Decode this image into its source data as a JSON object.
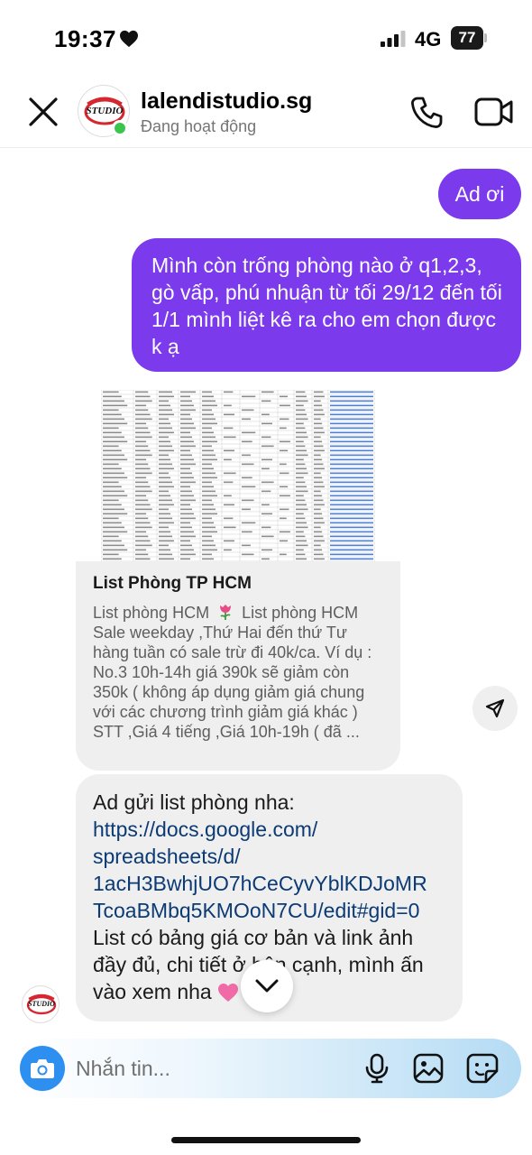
{
  "status_bar": {
    "time": "19:37",
    "network": "4G",
    "battery": "77"
  },
  "header": {
    "contact_name": "lalendistudio.sg",
    "contact_status": "Đang hoạt động",
    "avatar_logo_text": "STUDIO"
  },
  "messages": {
    "out_1": "Ad ơi",
    "out_2": "Mình còn trống phòng nào ở q1,2,3, gò vấp, phú nhuận từ tối 29/12 đến tối 1/1 mình liệt kê ra cho em chọn được k ạ",
    "link_card": {
      "title": "List Phòng TP HCM",
      "desc_1": "List phòng HCM",
      "desc_2": "List phòng HCM Sale weekday ,Thứ Hai đến thứ Tư hàng tuần có sale trừ đi 40k/ca. Ví dụ : No.3 10h-14h giá 390k sẽ giảm còn 350k ( không áp dụng giảm giá chung với các chương trình giảm giá khác ) STT ,Giá 4 tiếng ,Giá 10h-19h ( đã ..."
    },
    "in_1": {
      "intro": "Ad gửi list phòng nha:",
      "link_1": "https://docs.google.com/",
      "link_2": "spreadsheets/d/",
      "link_3": "1acH3BwhjUO7hCeCyvYblKDJoMR",
      "link_4": "TcoaBMbq5KMOoN7CU/edit#gid=0",
      "body": "List có bảng giá cơ bản và link ảnh đầy đủ, chi tiết ở bên cạnh, mình ấn vào xem nha"
    }
  },
  "composer": {
    "placeholder": "Nhắn tin..."
  },
  "colors": {
    "outgoing_bubble": "#7c3aed",
    "incoming_bubble": "#efefef",
    "link": "#0b3a74",
    "online": "#3cc54d",
    "camera_button": "#2d8ff0"
  },
  "icons": [
    "heart-icon",
    "signal-icon",
    "close-icon",
    "phone-icon",
    "video-icon",
    "send-icon",
    "chevron-down-icon",
    "camera-icon",
    "mic-icon",
    "gallery-icon",
    "sticker-icon",
    "tulip-icon"
  ]
}
